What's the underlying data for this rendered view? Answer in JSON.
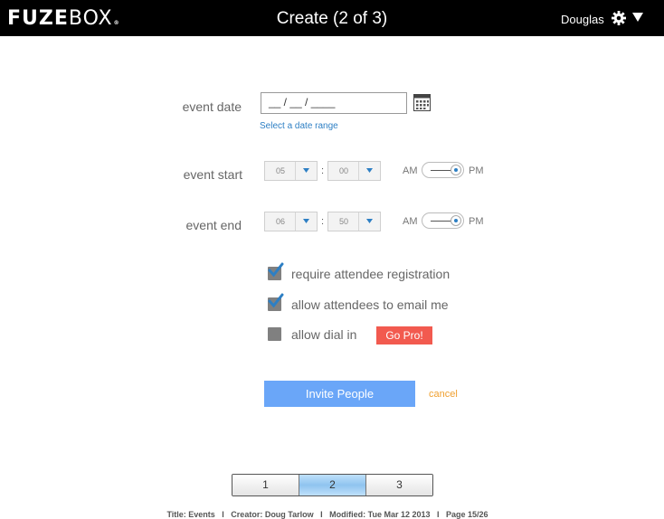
{
  "header": {
    "logo_fuze": "FUZE",
    "logo_box": "BOX",
    "logo_mark": "®",
    "title": "Create (2 of 3)",
    "user_name": "Douglas"
  },
  "form": {
    "event_date": {
      "label": "event date",
      "value": "__ / __ / ____",
      "range_link": "Select a date range"
    },
    "event_start": {
      "label": "event start",
      "hour": "05",
      "minute": "00",
      "separator": ":",
      "am_label": "AM",
      "pm_label": "PM",
      "period": "PM"
    },
    "event_end": {
      "label": "event end",
      "hour": "06",
      "minute": "50",
      "separator": ":",
      "am_label": "AM",
      "pm_label": "PM",
      "period": "PM"
    },
    "options": [
      {
        "label": "require attendee registration",
        "checked": true
      },
      {
        "label": "allow attendees to email me",
        "checked": true
      },
      {
        "label": "allow dial in",
        "checked": false
      }
    ],
    "go_pro_label": "Go Pro!"
  },
  "actions": {
    "invite_label": "Invite People",
    "cancel_label": "cancel"
  },
  "pager": {
    "pages": [
      "1",
      "2",
      "3"
    ],
    "current": "2"
  },
  "footer": {
    "text": "Title: Events   I   Creator: Doug Tarlow   I   Modified: Tue Mar 12 2013   I   Page 15/26"
  },
  "colors": {
    "topbar": "#000000",
    "link": "#2d7fc4",
    "invite_button": "#6aa6f8",
    "cancel": "#f0a030",
    "go_pro": "#f25a4f",
    "checkbox": "#808080",
    "pager_active": "#8fc4ef"
  },
  "icons": {
    "settings": "gear-icon",
    "menu": "caret-down-icon",
    "calendar": "calendar-icon",
    "select_arrow": "chevron-down-icon",
    "check": "checkmark-icon"
  }
}
